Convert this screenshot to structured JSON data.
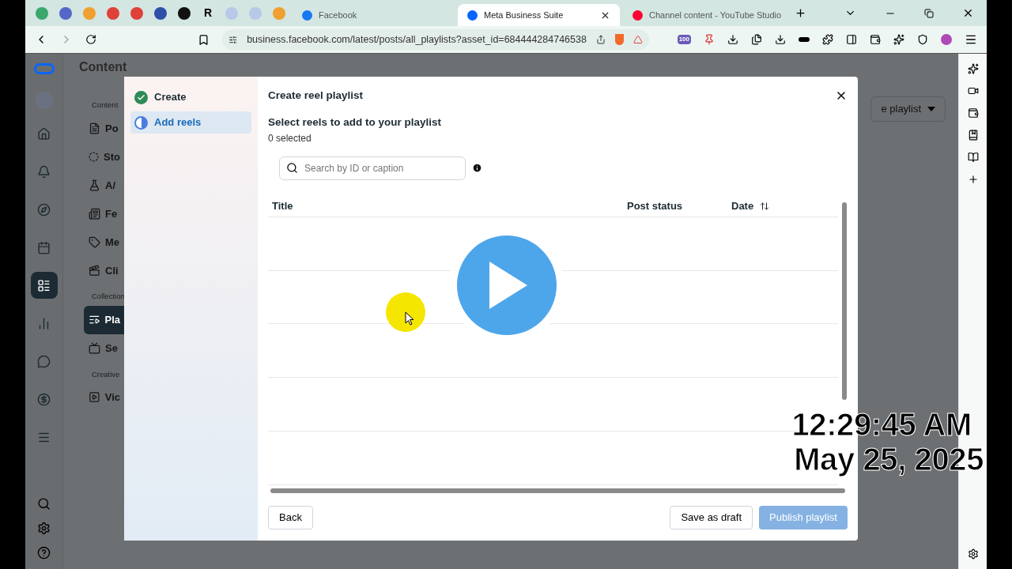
{
  "browser": {
    "pinned_tabs": [
      {
        "kind": "icon",
        "color": "#3aa76d"
      },
      {
        "kind": "icon",
        "color": "#5567c9"
      },
      {
        "kind": "icon",
        "color": "#f0a030"
      },
      {
        "kind": "icon",
        "color": "#e0403a"
      },
      {
        "kind": "icon",
        "color": "#e0403a"
      },
      {
        "kind": "icon",
        "color": "#2f4fa8"
      },
      {
        "kind": "icon",
        "color": "#111111"
      },
      {
        "kind": "letter",
        "label": "R"
      },
      {
        "kind": "icon",
        "color": "#b8c8e8"
      },
      {
        "kind": "icon",
        "color": "#b8c8e8"
      },
      {
        "kind": "icon",
        "color": "#f0a030"
      }
    ],
    "tabs": [
      {
        "label": "Facebook",
        "selected": false,
        "color": "#1877f2"
      },
      {
        "label": "Meta Business Suite",
        "selected": true,
        "color": "#0866ff"
      },
      {
        "label": "Channel content - YouTube Studio",
        "selected": false,
        "color": "#ff0033"
      }
    ],
    "url": "business.facebook.com/latest/posts/all_playlists?asset_id=684444284746538",
    "extension_badge": "100"
  },
  "page": {
    "breadcrumb": "Content",
    "rail": [
      {
        "selected": false
      },
      {
        "selected": false
      },
      {
        "selected": false
      },
      {
        "selected": false
      },
      {
        "selected": true
      },
      {
        "selected": false
      },
      {
        "selected": false
      },
      {
        "selected": false
      },
      {
        "selected": false
      }
    ],
    "nav": [
      {
        "kind": "heading",
        "label": "Content"
      },
      {
        "kind": "item",
        "label": "Po",
        "selected": false
      },
      {
        "kind": "item",
        "label": "Sto",
        "selected": false
      },
      {
        "kind": "item",
        "label": "A/",
        "selected": false
      },
      {
        "kind": "item",
        "label": "Fe",
        "selected": false
      },
      {
        "kind": "item",
        "label": "Me",
        "selected": false
      },
      {
        "kind": "item",
        "label": "Cli",
        "selected": false
      },
      {
        "kind": "heading",
        "label": "Collection"
      },
      {
        "kind": "item",
        "label": "Pla",
        "selected": true
      },
      {
        "kind": "item",
        "label": "Se",
        "selected": false
      },
      {
        "kind": "heading",
        "label": "Creative"
      },
      {
        "kind": "item",
        "label": "Vic",
        "selected": false
      }
    ],
    "create_button": "e playlist"
  },
  "modal": {
    "steps": [
      {
        "label": "Create",
        "done": true,
        "selected": false
      },
      {
        "label": "Add reels",
        "done": false,
        "selected": true
      }
    ],
    "title": "Create reel playlist",
    "heading": "Select reels to add to your playlist",
    "count": "0 selected",
    "search": {
      "placeholder": "Search by ID or caption"
    },
    "columns": [
      "Title",
      "Post status",
      "Date"
    ],
    "back": "Back",
    "save": "Save as draft",
    "publish": {
      "label": "Publish playlist",
      "disabled": true
    }
  },
  "overlay": {
    "time": "12:29:45 AM",
    "date": "May 25, 2025"
  }
}
